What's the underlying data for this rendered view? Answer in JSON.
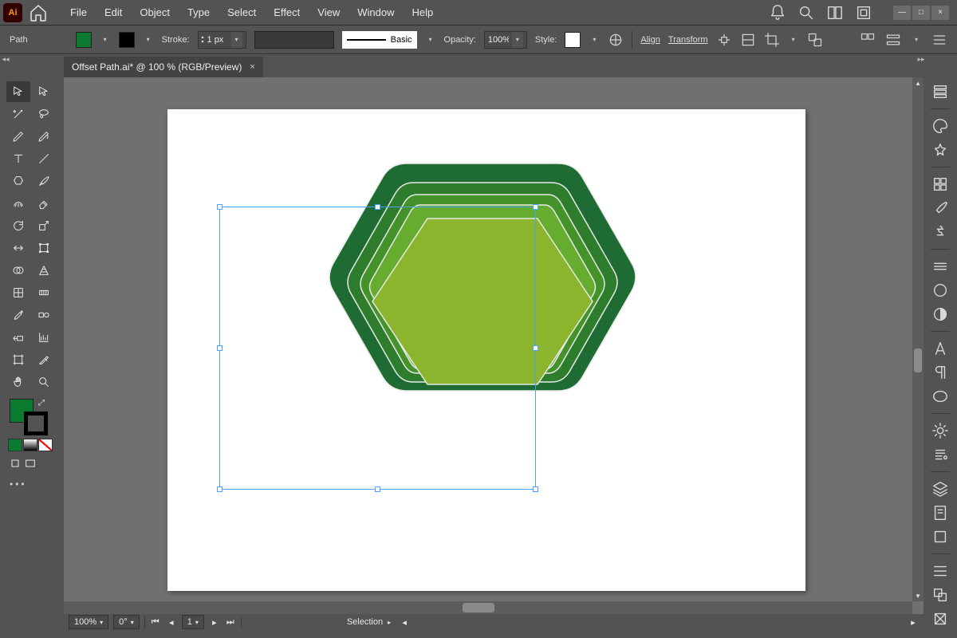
{
  "app": {
    "logo_text": "Ai"
  },
  "menu": {
    "items": [
      "File",
      "Edit",
      "Object",
      "Type",
      "Select",
      "Effect",
      "View",
      "Window",
      "Help"
    ]
  },
  "control": {
    "selection_label": "Path",
    "stroke_label": "Stroke:",
    "stroke_value": "1 px",
    "basic_label": "Basic",
    "opacity_label": "Opacity:",
    "opacity_value": "100%",
    "style_label": "Style:",
    "align_label": "Align",
    "transform_label": "Transform"
  },
  "document": {
    "tab_title": "Offset Path.ai* @ 100 % (RGB/Preview)",
    "close": "×"
  },
  "status": {
    "zoom": "100%",
    "rotate": "0°",
    "artboard_nav": "1",
    "tool_hint": "Selection"
  },
  "artwork": {
    "hex_colors": [
      "#1e6b33",
      "#2d7d2d",
      "#44932a",
      "#66ac2e",
      "#8bb52c"
    ]
  }
}
